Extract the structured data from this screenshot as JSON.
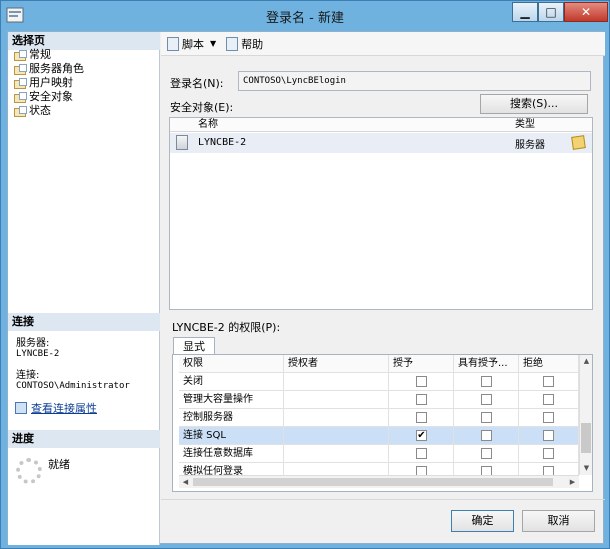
{
  "window": {
    "title": "登录名 - 新建",
    "minimize": "▁",
    "maximize": "□",
    "close": "✕"
  },
  "left": {
    "select_page_heading": "选择页",
    "pages": [
      "常规",
      "服务器角色",
      "用户映射",
      "安全对象",
      "状态"
    ],
    "connection_heading": "连接",
    "server_label": "服务器:",
    "server_value": "LYNCBE-2",
    "connection_label": "连接:",
    "connection_value": "CONTOSO\\Administrator",
    "view_connection_link": "查看连接属性",
    "progress_heading": "进度",
    "progress_status": "就绪"
  },
  "toolbar": {
    "script_label": "脚本",
    "help_label": "帮助"
  },
  "form": {
    "login_name_label": "登录名(N):",
    "login_name_value": "CONTOSO\\LyncBElogin",
    "securables_label": "安全对象(E):",
    "search_button": "搜索(S)..."
  },
  "securables_table": {
    "headers": {
      "name": "名称",
      "type": "类型"
    },
    "rows": [
      {
        "name": "LYNCBE-2",
        "type": "服务器"
      }
    ]
  },
  "permissions": {
    "label": "LYNCBE-2 的权限(P):",
    "tab_label": "显式",
    "headers": [
      "权限",
      "授权者",
      "授予",
      "具有授予...",
      "拒绝"
    ],
    "rows": [
      {
        "name": "关闭",
        "grantor": "",
        "grant": false,
        "with_grant": false,
        "deny": false,
        "selected": false
      },
      {
        "name": "管理大容量操作",
        "grantor": "",
        "grant": false,
        "with_grant": false,
        "deny": false,
        "selected": false
      },
      {
        "name": "控制服务器",
        "grantor": "",
        "grant": false,
        "with_grant": false,
        "deny": false,
        "selected": false
      },
      {
        "name": "连接 SQL",
        "grantor": "",
        "grant": true,
        "with_grant": false,
        "deny": false,
        "selected": true
      },
      {
        "name": "连接任意数据库",
        "grantor": "",
        "grant": false,
        "with_grant": false,
        "deny": false,
        "selected": false
      },
      {
        "name": "模拟任何登录",
        "grantor": "",
        "grant": false,
        "with_grant": false,
        "deny": false,
        "selected": false
      }
    ]
  },
  "footer": {
    "ok": "确定",
    "cancel": "取消"
  }
}
